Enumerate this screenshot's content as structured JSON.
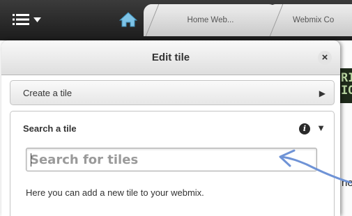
{
  "toolbar": {
    "menu_icon": "hamburger-menu-icon",
    "home_icon": "home-icon",
    "tabs": [
      {
        "label": "Home Web..."
      },
      {
        "label": "Webmix Co"
      }
    ]
  },
  "background_page": {
    "logo_fragment": [
      "RI",
      "IO"
    ],
    "text_fragment": "ne"
  },
  "modal": {
    "title": "Edit tile",
    "close_label": "×",
    "sections": {
      "create": {
        "label": "Create a tile",
        "expand_icon": "▶"
      },
      "search": {
        "label": "Search a tile",
        "info_label": "i",
        "collapse_icon": "▼",
        "input": {
          "value": "",
          "placeholder": "Search for tiles"
        },
        "help_text": "Here you can add a new tile to your webmix."
      }
    }
  },
  "colors": {
    "topbar": "#2a2a2a",
    "annotation_arrow": "#6f93d6"
  }
}
